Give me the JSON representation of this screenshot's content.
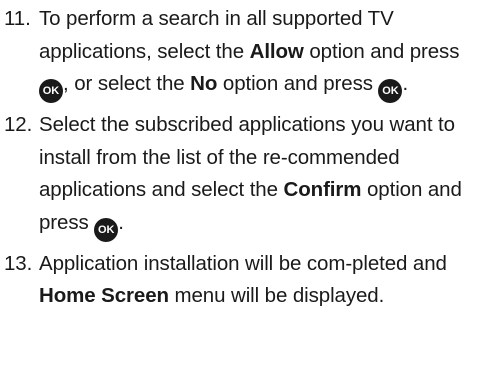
{
  "ok_button": {
    "label": "OK",
    "icon": "ok-button-icon",
    "color": "#1a1a1a"
  },
  "steps": [
    {
      "number": "11.",
      "parts": {
        "t1": "To perform a search in all supported TV applications, select the ",
        "b1": "Allow",
        "t2": " option and press ",
        "t3": ", or select the ",
        "b2": "No",
        "t4": " option and press ",
        "t5": "."
      }
    },
    {
      "number": "12.",
      "parts": {
        "t1": "Select the subscribed applications you want to install from the list of the re-commended applications and select the ",
        "b1": "Confirm",
        "t2": " option and press ",
        "t3": "."
      }
    },
    {
      "number": "13.",
      "parts": {
        "t1": "Application installation will be com-pleted and ",
        "b1": "Home Screen",
        "t2": " menu will be displayed."
      }
    }
  ]
}
